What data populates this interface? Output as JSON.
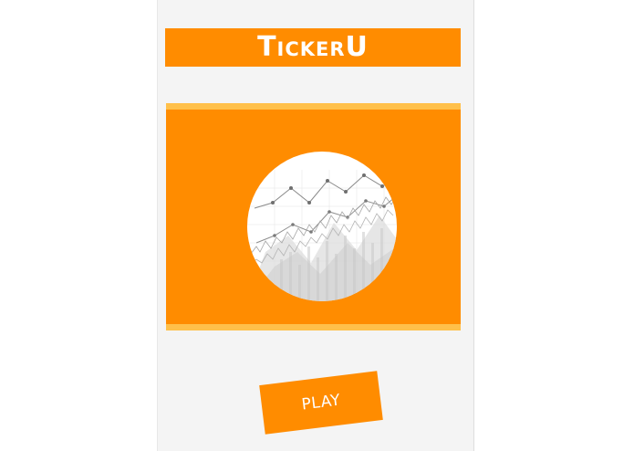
{
  "app": {
    "title": "TickerU",
    "colors": {
      "brand_orange": "#ff8c00",
      "accent_yellow": "#ffc04a",
      "background": "#f4f4f4"
    }
  },
  "hero": {
    "image": "stock-chart-illustration"
  },
  "actions": {
    "play_label": "PLAY"
  }
}
